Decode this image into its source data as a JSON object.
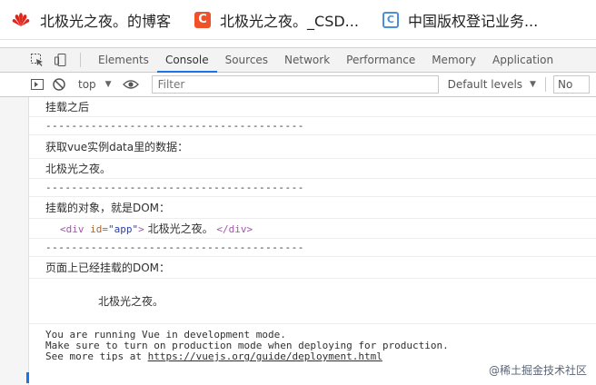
{
  "bookmarks": [
    {
      "icon": "huawei-logo-icon",
      "title": "北极光之夜。的博客"
    },
    {
      "icon": "csdn-logo-icon",
      "glyph": "C",
      "title": "北极光之夜。_CSD..."
    },
    {
      "icon": "gov-logo-icon",
      "glyph": "C",
      "title": "中国版权登记业务..."
    }
  ],
  "devtools": {
    "tabs": [
      "Elements",
      "Console",
      "Sources",
      "Network",
      "Performance",
      "Memory",
      "Application"
    ],
    "active_tab": "Console",
    "toolbar": {
      "context": "top",
      "filter_placeholder": "Filter",
      "levels": "Default levels",
      "no_issues": "No"
    }
  },
  "console": {
    "lines": [
      "挂载之后",
      "----------------------------------------",
      "获取vue实例data里的数据：",
      "北极光之夜。",
      "----------------------------------------",
      "挂载的对象，就是DOM：",
      "----------------------------------------",
      "页面上已经挂载的DOM：",
      "北极光之夜。"
    ],
    "element": {
      "tag_open": "<div",
      "attr_name": "id",
      "attr_val": "\"app\"",
      "tag_close_open": ">",
      "text": " 北极光之夜。 ",
      "tag_close": "</div>"
    },
    "vue_notice": [
      "You are running Vue in development mode.",
      "Make sure to turn on production mode when deploying for production.",
      "See more tips at "
    ],
    "vue_link": "https://vuejs.org/guide/deployment.html"
  },
  "watermark": "@稀土掘金技术社区"
}
